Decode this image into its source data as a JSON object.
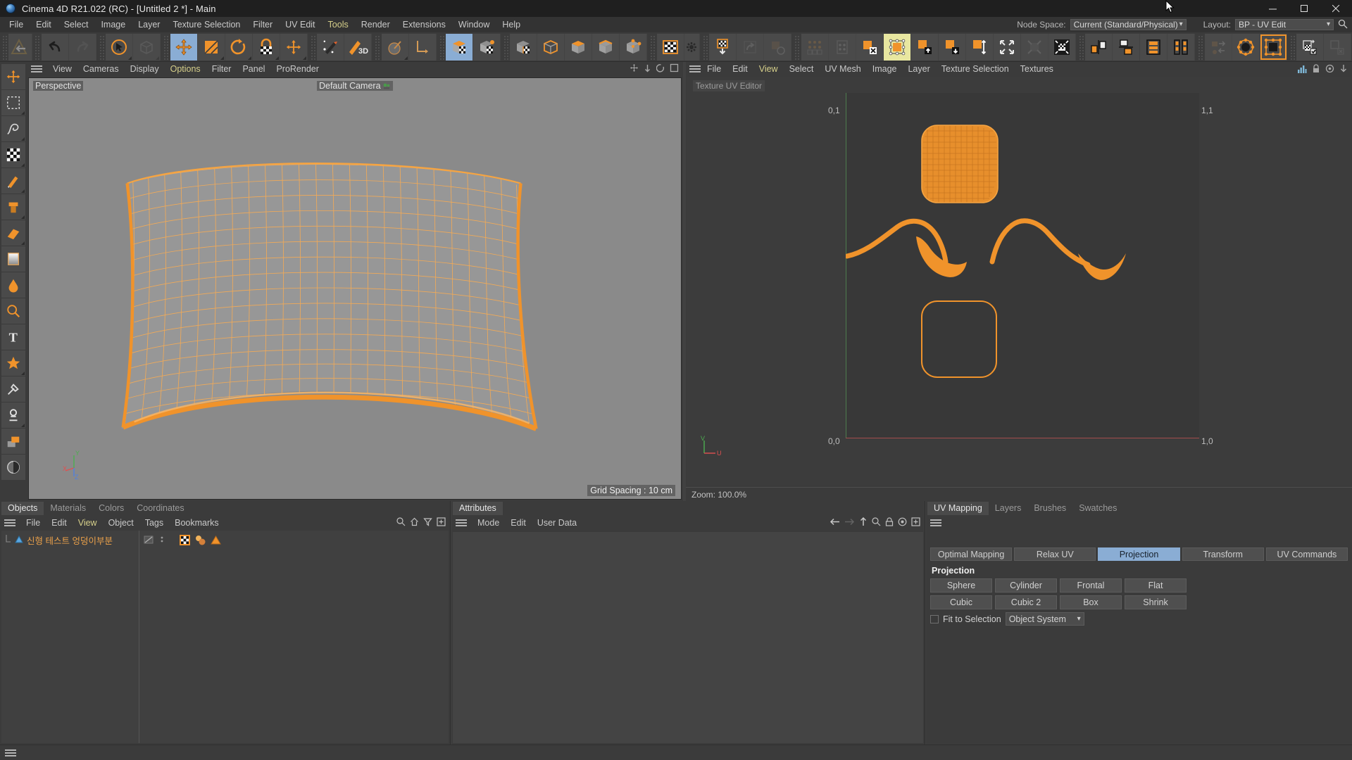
{
  "window": {
    "title": "Cinema 4D R21.022 (RC) - [Untitled 2 *] - Main",
    "app_icon": "cinema4d-logo-icon",
    "minimize": "—",
    "maximize": "☐",
    "close": "✕"
  },
  "menubar": {
    "items": [
      {
        "label": "File",
        "highlight": false
      },
      {
        "label": "Edit",
        "highlight": false
      },
      {
        "label": "Select",
        "highlight": false
      },
      {
        "label": "Image",
        "highlight": false
      },
      {
        "label": "Layer",
        "highlight": false
      },
      {
        "label": "Texture Selection",
        "highlight": false
      },
      {
        "label": "Filter",
        "highlight": false
      },
      {
        "label": "UV Edit",
        "highlight": false
      },
      {
        "label": "Tools",
        "highlight": true
      },
      {
        "label": "Render",
        "highlight": false
      },
      {
        "label": "Extensions",
        "highlight": false
      },
      {
        "label": "Window",
        "highlight": false
      },
      {
        "label": "Help",
        "highlight": false
      }
    ],
    "node_space_label": "Node Space:",
    "node_space_value": "Current (Standard/Physical)",
    "layout_label": "Layout:",
    "layout_value": "BP - UV Edit",
    "search_icon": "search-icon"
  },
  "main_toolbar": {
    "groups": [
      {
        "name": "undo-redo",
        "buttons": [
          {
            "name": "undo-button",
            "icon": "undo-arrow-icon",
            "state": "normal"
          },
          {
            "name": "redo-button",
            "icon": "redo-arrow-icon",
            "state": "disabled"
          }
        ]
      },
      {
        "name": "selection-tools",
        "buttons": [
          {
            "name": "live-selection-button",
            "icon": "cursor-circle-icon",
            "state": "normal",
            "flyout": true
          },
          {
            "name": "box-select-button",
            "icon": "cube-outline-icon",
            "state": "disabled",
            "flyout": true
          }
        ]
      },
      {
        "name": "transform-tools",
        "buttons": [
          {
            "name": "move-tool-button",
            "icon": "move-arrows-icon",
            "state": "selected"
          },
          {
            "name": "scale-tool-button",
            "icon": "scale-square-icon",
            "state": "normal",
            "flyout": true
          },
          {
            "name": "rotate-tool-button",
            "icon": "rotate-circle-icon",
            "state": "normal",
            "flyout": true
          },
          {
            "name": "lock-axis-button",
            "icon": "lock-checker-icon",
            "state": "normal",
            "flyout": true
          },
          {
            "name": "world-axis-button",
            "icon": "move-arrows-small-icon",
            "state": "normal",
            "flyout": true
          }
        ]
      },
      {
        "name": "paint-tools",
        "buttons": [
          {
            "name": "magic-wand-button",
            "icon": "magic-brush-icon",
            "state": "normal"
          },
          {
            "name": "paint-3d-button",
            "icon": "brush-3d-icon",
            "state": "normal"
          }
        ]
      },
      {
        "name": "render-tools",
        "buttons": [
          {
            "name": "render-view-button",
            "icon": "render-sphere-icon",
            "state": "normal",
            "flyout": true
          },
          {
            "name": "coordinate-system-button",
            "icon": "axis-corner-icon",
            "state": "normal"
          }
        ]
      },
      {
        "name": "mode-tools",
        "buttons": [
          {
            "name": "texture-mode-button",
            "icon": "cube-checker-icon",
            "state": "selected"
          },
          {
            "name": "uv-mode-button",
            "icon": "cube-checker-dot-icon",
            "state": "normal"
          }
        ]
      },
      {
        "name": "component-modes",
        "buttons": [
          {
            "name": "texture-polygon-button",
            "icon": "cube-checker2-icon",
            "state": "normal"
          },
          {
            "name": "uv-edge-button",
            "icon": "cube-wire-icon",
            "state": "normal"
          },
          {
            "name": "uv-point-button",
            "icon": "cube-top-icon",
            "state": "normal"
          },
          {
            "name": "uv-poly-button",
            "icon": "cube-edge-icon",
            "state": "normal"
          },
          {
            "name": "uv-vertex-button",
            "icon": "cube-dots-icon",
            "state": "normal"
          }
        ]
      },
      {
        "name": "uv-texture-group",
        "buttons": [
          {
            "name": "texture-view-button",
            "icon": "checker-frame-icon",
            "state": "normal"
          },
          {
            "name": "texture-settings-button",
            "icon": "gear-icon",
            "state": "normal"
          }
        ]
      },
      {
        "name": "uv-apply-group",
        "buttons": [
          {
            "name": "apply-uv-button",
            "icon": "checker-down-arrow-icon",
            "state": "normal"
          },
          {
            "name": "redo-uv-button",
            "icon": "arrow-square-icon",
            "state": "disabled"
          },
          {
            "name": "recycle-uv-button",
            "icon": "recycle-square-icon",
            "state": "disabled"
          }
        ]
      },
      {
        "name": "uv-select-group",
        "buttons": [
          {
            "name": "select-points-button",
            "icon": "dots-grid-icon",
            "state": "disabled"
          },
          {
            "name": "select-list-button",
            "icon": "list-dots-icon",
            "state": "disabled"
          },
          {
            "name": "deselect-button",
            "icon": "square-x-icon",
            "state": "normal"
          },
          {
            "name": "frame-selection-button",
            "icon": "square-handles-icon",
            "state": "selectedY"
          },
          {
            "name": "move-up-button",
            "icon": "square-up-arrow-icon",
            "state": "normal"
          },
          {
            "name": "move-down-button",
            "icon": "square-down-arrow-icon",
            "state": "normal"
          },
          {
            "name": "move-updown-button",
            "icon": "square-updown-arrow-icon",
            "state": "normal"
          },
          {
            "name": "expand-button",
            "icon": "expand-arrows-icon",
            "state": "normal"
          },
          {
            "name": "shrink-button",
            "icon": "shrink-arrows-icon",
            "state": "disabled"
          },
          {
            "name": "fit-button",
            "icon": "fit-checker-icon",
            "state": "normal"
          }
        ]
      },
      {
        "name": "uv-align-group",
        "buttons": [
          {
            "name": "align-left-button",
            "icon": "align-left-icon",
            "state": "normal"
          },
          {
            "name": "align-top-button",
            "icon": "align-top-icon",
            "state": "normal"
          },
          {
            "name": "distribute-h-button",
            "icon": "distribute-h-icon",
            "state": "normal"
          },
          {
            "name": "distribute-v-button",
            "icon": "distribute-v-icon",
            "state": "normal"
          }
        ]
      },
      {
        "name": "uv-shape-group",
        "buttons": [
          {
            "name": "swap-uv-button",
            "icon": "swap-arrows-icon",
            "state": "disabled"
          },
          {
            "name": "circle-uv-button",
            "icon": "circle-dots-icon",
            "state": "normal"
          },
          {
            "name": "rect-uv-button",
            "icon": "rect-dots-icon",
            "state": "selectedOrange"
          }
        ]
      },
      {
        "name": "uv-tag-group",
        "buttons": [
          {
            "name": "assign-tag-button",
            "icon": "tag-check-icon",
            "state": "normal"
          },
          {
            "name": "remove-tag-button",
            "icon": "tag-x-icon",
            "state": "disabled"
          }
        ]
      }
    ]
  },
  "left_palette": {
    "buttons": [
      {
        "name": "move-tool-left-button",
        "icon": "move-arrows-icon",
        "state": "normal"
      },
      {
        "name": "rect-select-button",
        "icon": "dashed-rect-icon",
        "state": "normal",
        "flyout": true
      },
      {
        "name": "lasso-select-button",
        "icon": "lasso-icon",
        "state": "normal",
        "flyout": true
      },
      {
        "name": "uv-polygon-select-button",
        "icon": "checker-grid-icon",
        "state": "normal",
        "flyout": true
      },
      {
        "name": "brush-button",
        "icon": "brush-icon",
        "state": "normal",
        "flyout": true
      },
      {
        "name": "eyedropper-fill-button",
        "icon": "fill-bucket-icon",
        "state": "normal",
        "flyout": true
      },
      {
        "name": "eraser-button",
        "icon": "eraser-icon",
        "state": "normal",
        "flyout": true
      },
      {
        "name": "gradient-button",
        "icon": "gradient-icon",
        "state": "normal",
        "flyout": true
      },
      {
        "name": "paint-drop-button",
        "icon": "water-drop-icon",
        "state": "normal"
      },
      {
        "name": "zoom-tool-button",
        "icon": "magnifier-icon",
        "state": "normal"
      },
      {
        "name": "text-tool-button",
        "icon": "text-t-icon",
        "state": "normal"
      },
      {
        "name": "star-tool-button",
        "icon": "star-icon",
        "state": "normal",
        "flyout": true
      },
      {
        "name": "color-picker-button",
        "icon": "eyedropper-icon",
        "state": "normal"
      },
      {
        "name": "stamp-tool-button",
        "icon": "stamp-icon",
        "state": "normal",
        "flyout": true
      },
      {
        "name": "layer-tool-button",
        "icon": "layer-icon",
        "state": "normal"
      },
      {
        "name": "mask-tool-button",
        "icon": "mask-circle-icon",
        "state": "normal"
      }
    ]
  },
  "viewport": {
    "menu": [
      {
        "label": "View",
        "highlight": false
      },
      {
        "label": "Cameras",
        "highlight": false
      },
      {
        "label": "Display",
        "highlight": false
      },
      {
        "label": "Options",
        "highlight": true
      },
      {
        "label": "Filter",
        "highlight": false
      },
      {
        "label": "Panel",
        "highlight": false
      },
      {
        "label": "ProRender",
        "highlight": false
      }
    ],
    "view_label": "Perspective",
    "camera_label": "Default Camera",
    "camera_icon": "camera-icon",
    "grid_spacing": "Grid Spacing : 10 cm",
    "axis_labels": {
      "x": "X",
      "y": "Y",
      "z": "Z"
    },
    "corner_icons": [
      "move-view-icon",
      "scale-view-icon",
      "rotate-view-icon",
      "maximize-view-icon"
    ]
  },
  "uv_editor": {
    "menu": [
      {
        "label": "File",
        "highlight": false
      },
      {
        "label": "Edit",
        "highlight": false
      },
      {
        "label": "View",
        "highlight": true
      },
      {
        "label": "Select",
        "highlight": false
      },
      {
        "label": "UV Mesh",
        "highlight": false
      },
      {
        "label": "Image",
        "highlight": false
      },
      {
        "label": "Layer",
        "highlight": false
      },
      {
        "label": "Texture Selection",
        "highlight": false
      },
      {
        "label": "Textures",
        "highlight": false
      }
    ],
    "title": "Texture UV Editor",
    "corner_labels": {
      "top_left": "0,1",
      "top_right": "1,1",
      "bottom_left": "0,0",
      "bottom_right": "1,0"
    },
    "axis_labels": {
      "u": "U",
      "v": "V"
    },
    "zoom_status": "Zoom: 100.0%",
    "toolbar_icons": [
      "histogram-icon",
      "lock-icon",
      "link-icon",
      "down-arrow-icon"
    ]
  },
  "objects_panel": {
    "tabs": [
      {
        "label": "Objects",
        "active": true
      },
      {
        "label": "Materials",
        "active": false
      },
      {
        "label": "Colors",
        "active": false
      },
      {
        "label": "Coordinates",
        "active": false
      }
    ],
    "menu": [
      {
        "label": "File",
        "highlight": false
      },
      {
        "label": "Edit",
        "highlight": false
      },
      {
        "label": "View",
        "highlight": true
      },
      {
        "label": "Object",
        "highlight": false
      },
      {
        "label": "Tags",
        "highlight": false
      },
      {
        "label": "Bookmarks",
        "highlight": false
      }
    ],
    "header_icons": [
      "search-icon",
      "home-icon",
      "filter-icon",
      "plus-box-icon"
    ],
    "rows": [
      {
        "name": "신형 테스트 엉덩이부분",
        "object_icon": "polygon-object-icon",
        "tags": [
          "uv-tag-icon",
          "material-tag-icon",
          "phong-tag-icon"
        ],
        "visibility_dots": 2
      }
    ]
  },
  "attributes_panel": {
    "tabs": [
      {
        "label": "Attributes",
        "active": true
      }
    ],
    "menu": [
      {
        "label": "Mode",
        "highlight": false
      },
      {
        "label": "Edit",
        "highlight": false
      },
      {
        "label": "User Data",
        "highlight": false
      }
    ],
    "header_icons": [
      "back-arrow-icon",
      "forward-arrow-icon",
      "up-arrow-icon",
      "search-icon",
      "lock-icon",
      "target-icon",
      "plus-box-icon"
    ]
  },
  "uv_mapping_panel": {
    "tabs": [
      {
        "label": "UV Mapping",
        "active": true
      },
      {
        "label": "Layers",
        "active": false
      },
      {
        "label": "Brushes",
        "active": false
      },
      {
        "label": "Swatches",
        "active": false
      }
    ],
    "segments": [
      {
        "label": "Optimal Mapping",
        "active": false
      },
      {
        "label": "Relax UV",
        "active": false
      },
      {
        "label": "Projection",
        "active": true
      },
      {
        "label": "Transform",
        "active": false
      },
      {
        "label": "UV Commands",
        "active": false
      }
    ],
    "section_title": "Projection",
    "buttons_row1": [
      "Sphere",
      "Cylinder",
      "Frontal",
      "Flat"
    ],
    "buttons_row2": [
      "Cubic",
      "Cubic 2",
      "Box",
      "Shrink"
    ],
    "fit_to_selection_label": "Fit to Selection",
    "fit_to_selection_checked": false,
    "coordinate_system_value": "Object System"
  },
  "colors": {
    "orange": "#f0932b",
    "orange_light": "#f5ab55",
    "accent_blue": "#8aadd4",
    "panel_bg": "#3b3b3b",
    "viewport_bg": "#8a8a8a",
    "uv_bg": "#3c3c3c",
    "title_bg": "#1f1f1f",
    "menu_highlight": "#d6cf8a"
  }
}
